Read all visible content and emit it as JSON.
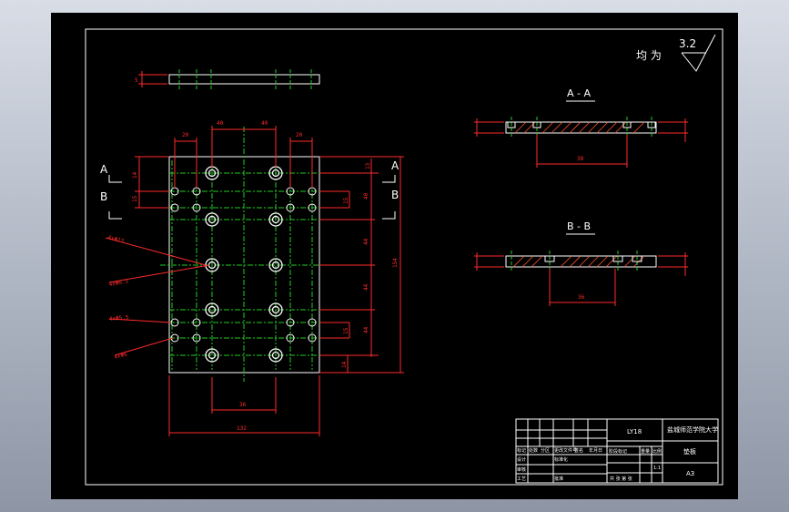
{
  "surface_roughness": {
    "label": "均 为",
    "value": "3.2"
  },
  "sections": {
    "aa_title": "A - A",
    "bb_title": "B - B",
    "aa_dim": "38",
    "bb_dim": "36"
  },
  "section_markers": {
    "a": "A",
    "b": "B"
  },
  "top_view": {
    "thickness": "5"
  },
  "main_dims": {
    "d40a": "40",
    "d40b": "40",
    "d20a": "20",
    "d20b": "20",
    "d36": "36",
    "d132": "132",
    "d154": "154",
    "v14a": "14",
    "v15a": "15",
    "v15b": "15",
    "v14b": "14",
    "r13a": "13",
    "r40a": "40",
    "r44a": "44",
    "r44b": "44",
    "r44c": "44",
    "r15": "15",
    "r14": "14"
  },
  "hole_callouts": [
    "4xΦ13",
    "4xΦ6.5",
    "4xΦ5.5",
    "4xΦ6"
  ],
  "title_block": {
    "drawing_no": "LY18",
    "school": "盐城师范学院大学",
    "part_name": "垫板",
    "scale_label": "比例",
    "scale": "1:1",
    "sheet": "A3",
    "row_labels": [
      "标记",
      "处数",
      "分区",
      "更改文件号",
      "签名",
      "年月日"
    ],
    "design": "设计",
    "std": "标准化",
    "stage": "阶段标记",
    "weight": "重量",
    "audit": "审核",
    "process": "工艺",
    "approve": "批准",
    "sheets": "共 张 第 张"
  },
  "colors": {
    "background": "#000000",
    "outline": "#ffffff",
    "center_lines": "#22cc22",
    "dimensions": "#ff2a2a",
    "hatch": "#ff5533"
  }
}
